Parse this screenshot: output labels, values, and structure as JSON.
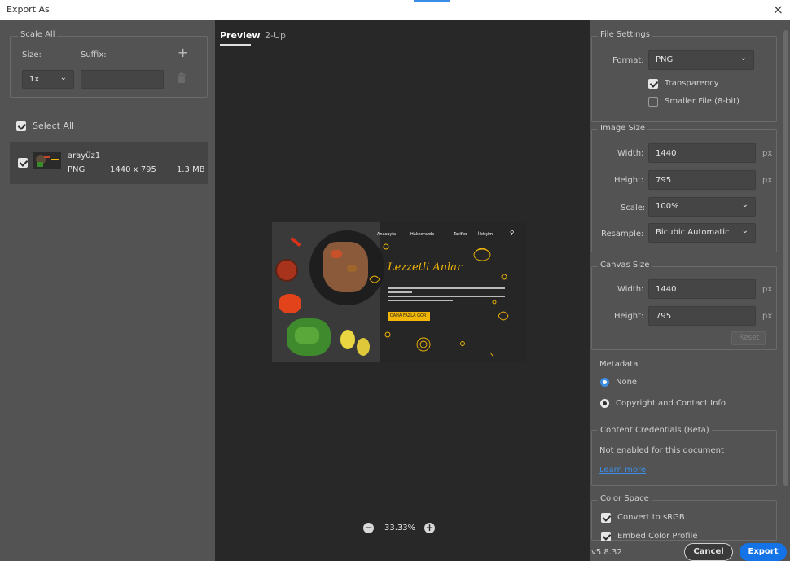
{
  "window": {
    "title": "Export As"
  },
  "left": {
    "scale_all": {
      "title": "Scale All",
      "size_label": "Size:",
      "suffix_label": "Suffix:",
      "scale_value": "1x",
      "suffix_value": ""
    },
    "select_all_label": "Select All",
    "asset": {
      "name": "arayüz1",
      "format": "PNG",
      "dimensions": "1440 x 795",
      "size": "1.3 MB"
    }
  },
  "center": {
    "tabs": [
      "Preview",
      "2-Up"
    ],
    "zoom": "33.33%",
    "artwork": {
      "nav": [
        "Anasayfa",
        "Hakkımızda",
        "Tarifler",
        "İletişim"
      ],
      "headline": "Lezzetli Anlar",
      "cta": "DAHA FAZLA GÖR"
    }
  },
  "right": {
    "file_settings": {
      "title": "File Settings",
      "format_label": "Format:",
      "format_value": "PNG",
      "transparency_label": "Transparency",
      "smaller_file_label": "Smaller File (8-bit)"
    },
    "image_size": {
      "title": "Image Size",
      "width_label": "Width:",
      "width_value": "1440",
      "height_label": "Height:",
      "height_value": "795",
      "scale_label": "Scale:",
      "scale_value": "100%",
      "resample_label": "Resample:",
      "resample_value": "Bicubic Automatic",
      "unit": "px"
    },
    "canvas_size": {
      "title": "Canvas Size",
      "width_label": "Width:",
      "width_value": "1440",
      "height_label": "Height:",
      "height_value": "795",
      "unit": "px",
      "reset_label": "Reset"
    },
    "metadata": {
      "title": "Metadata",
      "none_label": "None",
      "copyright_label": "Copyright and Contact Info"
    },
    "content_credentials": {
      "title": "Content Credentials (Beta)",
      "status": "Not enabled for this document",
      "learn_more": "Learn more"
    },
    "color_space": {
      "title": "Color Space",
      "convert_label": "Convert to sRGB",
      "embed_label": "Embed Color Profile"
    }
  },
  "footer": {
    "version": "v5.8.32",
    "cancel_label": "Cancel",
    "export_label": "Export"
  },
  "colors": {
    "accent": "#3a8ee6",
    "artwork_yellow": "#f2b705",
    "panel": "#535353",
    "canvas": "#282828"
  }
}
